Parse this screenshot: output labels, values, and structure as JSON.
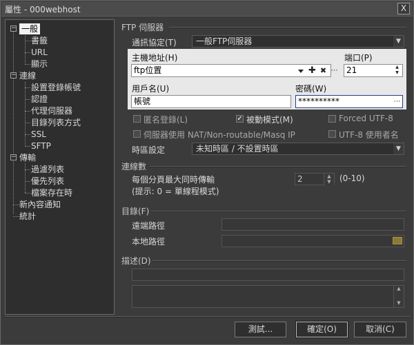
{
  "window": {
    "title": "屬性 - 000webhost",
    "close_glyph": "X"
  },
  "tree": {
    "general": "一般",
    "bookmark": "書籤",
    "url": "URL",
    "display": "顯示",
    "connection": "連線",
    "login_account": "設置登錄帳號",
    "auth": "認證",
    "proxy": "代理伺服器",
    "list_mode": "目錄列表方式",
    "ssl": "SSL",
    "sftp": "SFTP",
    "transfer": "傳輸",
    "filter": "過濾列表",
    "priority": "優先列表",
    "file_exists": "檔案存在時",
    "notify": "新內容通知",
    "stats": "統計"
  },
  "ftp": {
    "header": "FTP 伺服器",
    "protocol_label": "通訊協定(T)",
    "protocol_value": "一般FTP伺服器",
    "host_label": "主機地址(H)",
    "host_value": "ftp位置",
    "port_label": "端口(P)",
    "port_value": "21",
    "user_label": "用戶名(U)",
    "user_value": "帳號",
    "password_label": "密碼(W)",
    "password_value": "**********",
    "anon_label": "匿名登錄(L)",
    "passive_label": "被動模式(M)",
    "forced_utf8_label": "Forced UTF-8",
    "nat_label": "伺服器使用 NAT/Non-routable/Masq IP",
    "utf8_names_label": "UTF-8 使用者名",
    "timezone_label": "時區設定",
    "timezone_value": "未知時區 / 不設置時區",
    "passive_checked": true
  },
  "connections": {
    "header": "連線數",
    "per_page_label": "每個分頁最大同時傳輸",
    "per_page_value": "2",
    "range_text": "(0-10)",
    "hint_text": "(提示: 0 = 單線程模式)"
  },
  "directory": {
    "header": "目錄(F)",
    "remote_label": "遠端路徑",
    "local_label": "本地路徑"
  },
  "description": {
    "header": "描述(D)"
  },
  "buttons": {
    "test": "測試...",
    "ok": "確定(O)",
    "cancel": "取消(C)"
  },
  "colors": {
    "panel_bg": "#e8e8e8",
    "dialog_bg": "#3b3b3b",
    "focus_border": "#1e3d8f"
  }
}
